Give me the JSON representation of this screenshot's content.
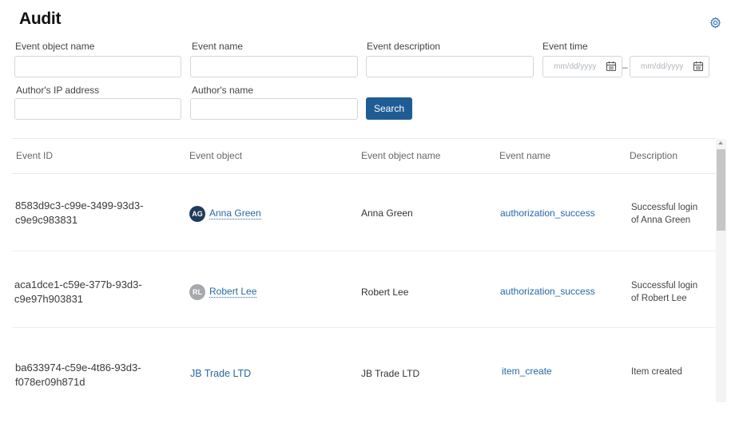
{
  "page": {
    "title": "Audit"
  },
  "filters": {
    "event_object_name": {
      "label": "Event object name",
      "value": ""
    },
    "event_name": {
      "label": "Event name",
      "value": ""
    },
    "event_description": {
      "label": "Event description",
      "value": ""
    },
    "event_time": {
      "label": "Event time",
      "from_placeholder": "mm/dd/yyyy",
      "to_placeholder": "mm/dd/yyyy",
      "separator": "–"
    },
    "author_ip": {
      "label": "Author's IP address",
      "value": ""
    },
    "author_name": {
      "label": "Author's name",
      "value": ""
    },
    "search_label": "Search"
  },
  "table": {
    "columns": [
      "Event ID",
      "Event object",
      "Event object name",
      "Event name",
      "Description"
    ],
    "rows": [
      {
        "id_line1": "8583d9c3-c99e-3499-93d3-",
        "id_line2": "c9e9c983831",
        "object": "Anna Green",
        "avatar_initials": "AG",
        "avatar_color": "#1f3b5c",
        "object_name": "Anna Green",
        "event_name": "authorization_success",
        "desc_line1": "Successful login",
        "desc_line2": "of Anna Green"
      },
      {
        "id_line1": "aca1dce1-c59e-377b-93d3-",
        "id_line2": "c9e97h903831",
        "object": "Robert Lee",
        "avatar_initials": "RL",
        "avatar_color": "#a5a9ad",
        "object_name": "Robert Lee",
        "event_name": "authorization_success",
        "desc_line1": "Successful login",
        "desc_line2": "of Robert Lee"
      },
      {
        "id_line1": "ba633974-c59e-4t86-93d3-",
        "id_line2": "f078er09h871d",
        "object": "JB Trade LTD",
        "object_name": "JB Trade LTD",
        "event_name": "item_create",
        "desc_line1": "Item created"
      }
    ]
  },
  "colors": {
    "accent": "#1f5c93",
    "link": "#2568a5"
  },
  "icons": {
    "settings": "gear-icon",
    "date_picker": "calendar-icon"
  }
}
